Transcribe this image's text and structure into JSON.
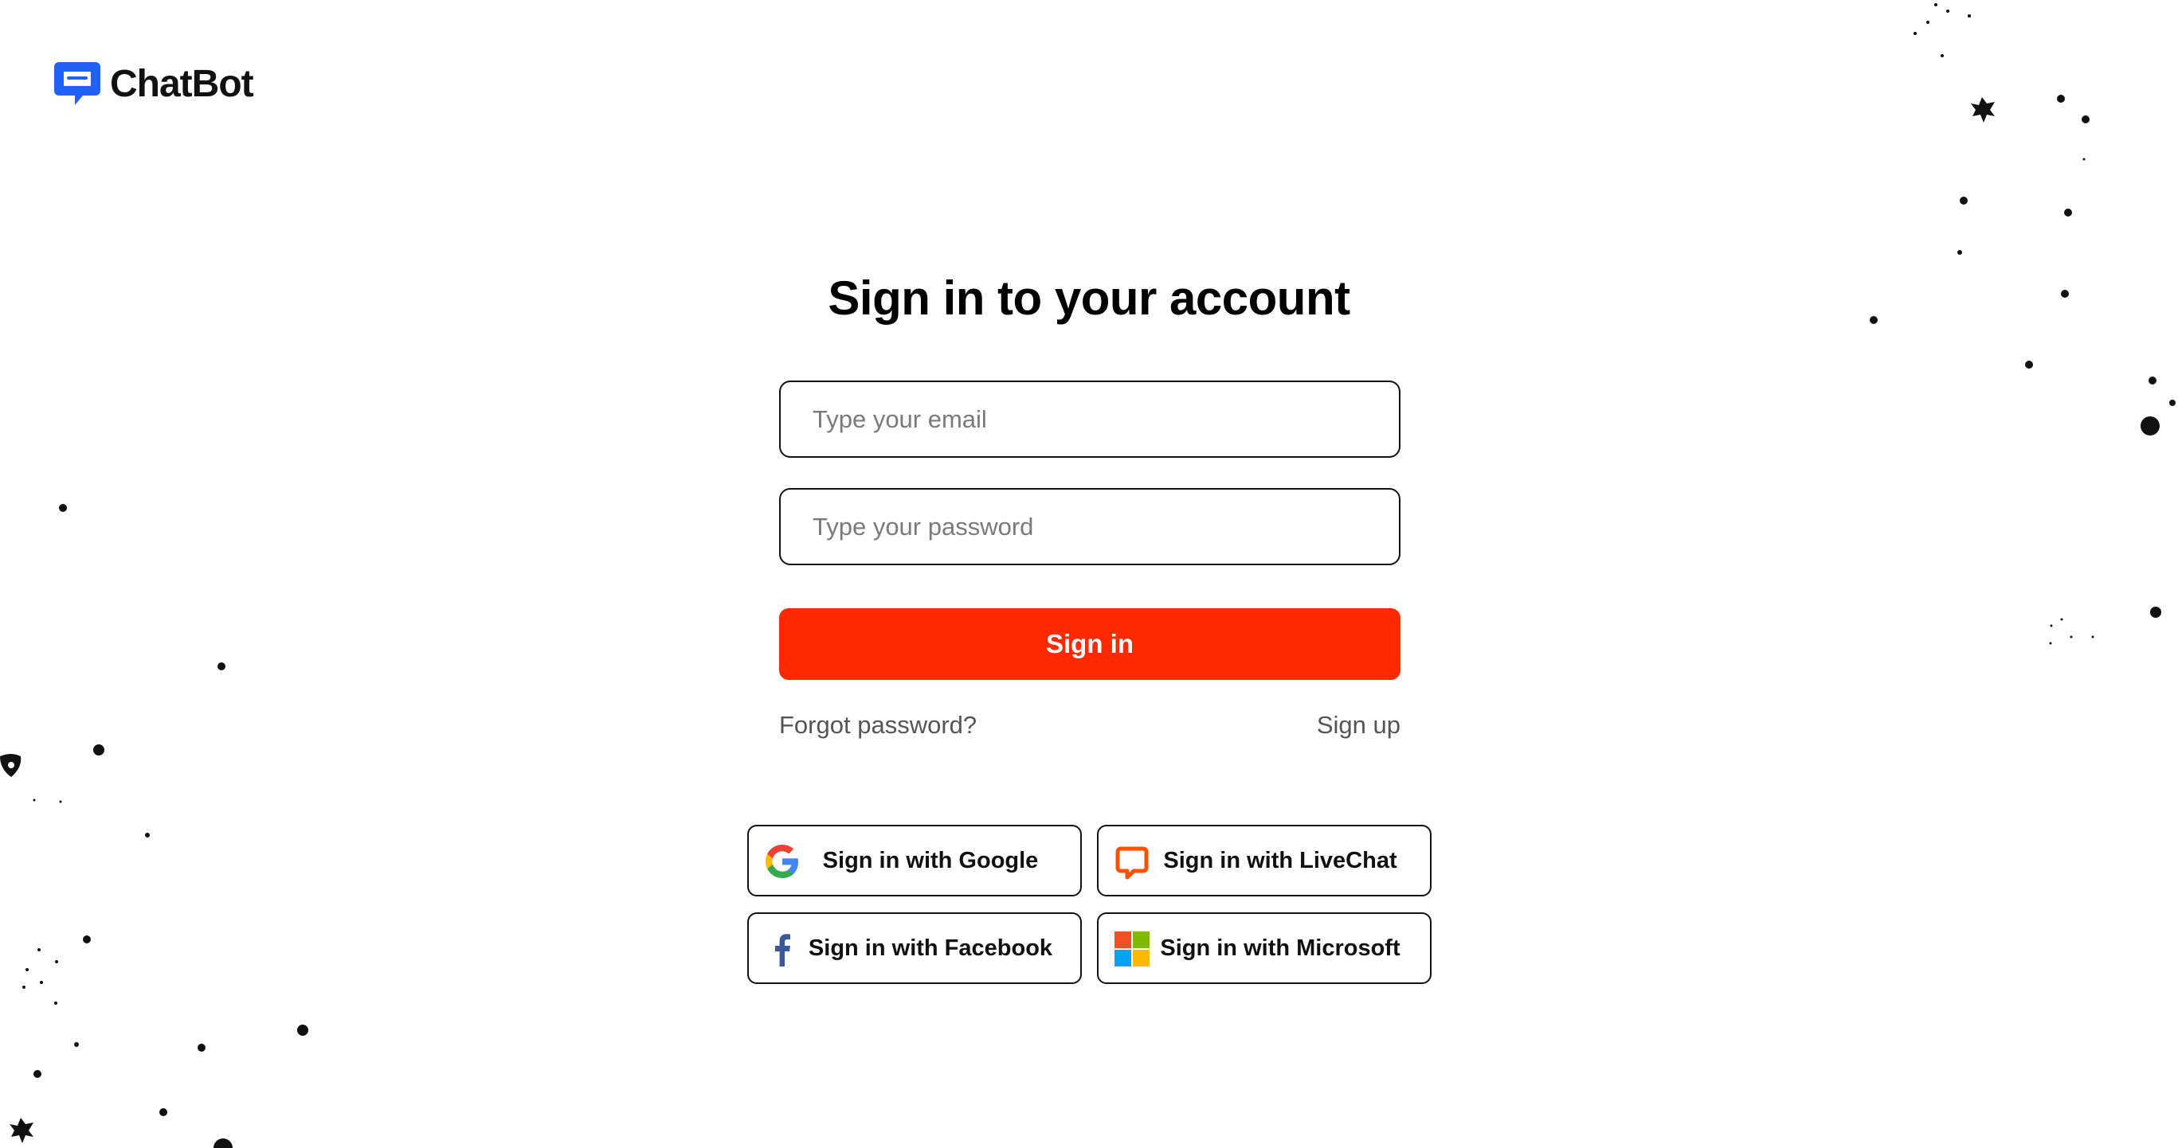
{
  "brand": {
    "name": "ChatBot",
    "accent_color": "#2162f6",
    "primary_button_color": "#ff2a00"
  },
  "form": {
    "title": "Sign in to your account",
    "email_placeholder": "Type your email",
    "password_placeholder": "Type your password",
    "email_value": "",
    "password_value": "",
    "submit_label": "Sign in",
    "forgot_link": "Forgot password?",
    "signup_link": "Sign up"
  },
  "social": {
    "google": {
      "label": "Sign in with Google",
      "icon": "google-icon"
    },
    "livechat": {
      "label": "Sign in with LiveChat",
      "icon": "livechat-icon"
    },
    "facebook": {
      "label": "Sign in with Facebook",
      "icon": "facebook-icon"
    },
    "microsoft": {
      "label": "Sign in with Microsoft",
      "icon": "microsoft-icon"
    }
  }
}
